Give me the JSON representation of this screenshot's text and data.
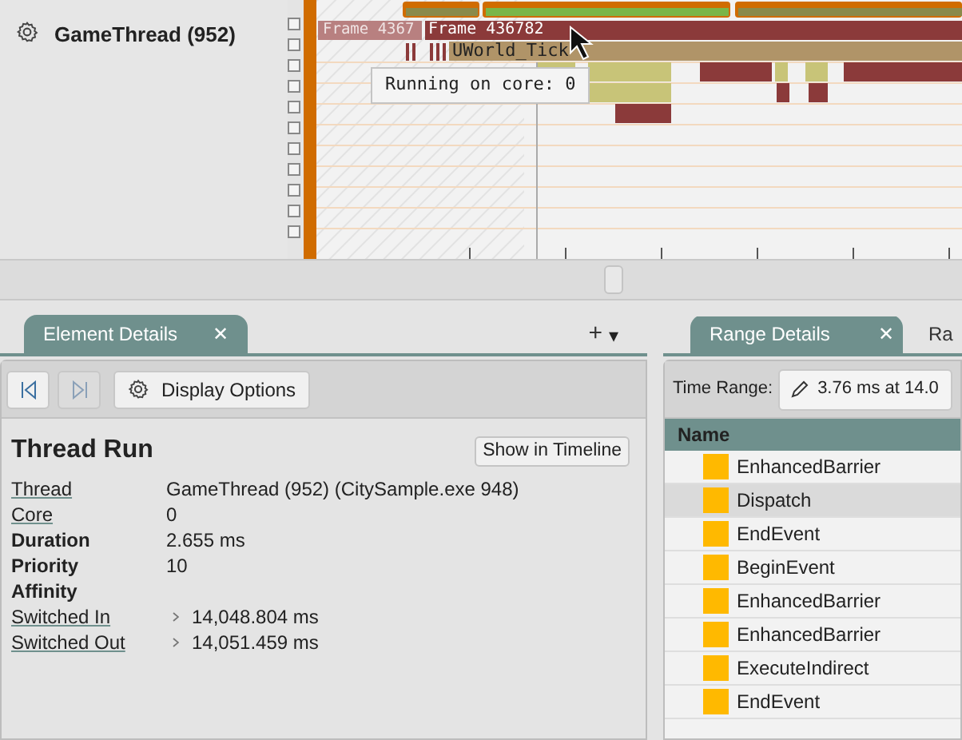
{
  "thread_track": {
    "name": "GameThread (952)",
    "lanes": [
      {
        "checked": false
      },
      {
        "checked": false
      },
      {
        "checked": false
      },
      {
        "checked": false
      },
      {
        "checked": false
      },
      {
        "checked": false
      },
      {
        "checked": false
      },
      {
        "checked": false
      },
      {
        "checked": false
      },
      {
        "checked": false
      },
      {
        "checked": false
      }
    ]
  },
  "timeline": {
    "frames": [
      "Frame 4367",
      "Frame 436782"
    ],
    "event": "UWorld_Tick",
    "tooltip": "Running on core: 0"
  },
  "element_panel": {
    "tab": {
      "label": "Element Details",
      "close": "✕",
      "selected": true
    },
    "add": "+",
    "menu": "▾",
    "display_options": "Display Options",
    "title": "Thread Run",
    "show_in_timeline": "Show in Timeline",
    "fields": [
      {
        "label": "Thread",
        "kind": "link",
        "value": "GameThread (952) (CitySample.exe 948)",
        "expandable": false
      },
      {
        "label": "Core",
        "kind": "link",
        "value": "0",
        "expandable": false
      },
      {
        "label": "Duration",
        "kind": "bold",
        "value": "2.655 ms",
        "expandable": false
      },
      {
        "label": "Priority",
        "kind": "bold",
        "value": "10",
        "expandable": false
      },
      {
        "label": "Affinity",
        "kind": "bold",
        "expandable": false
      },
      {
        "label": "Switched In",
        "kind": "link",
        "value": "14,048.804 ms",
        "expandable": true
      },
      {
        "label": "Switched Out",
        "kind": "link",
        "value": "14,051.459 ms",
        "expandable": true
      }
    ]
  },
  "range_panel": {
    "tabs": [
      {
        "label": "Range Details",
        "close": "✕",
        "selected": true
      },
      {
        "label": "Ra",
        "selected": false
      }
    ],
    "time_range_label": "Time Range:",
    "time_range_value": "3.76 ms at 14.0",
    "column": "Name",
    "rows": [
      {
        "name": "EnhancedBarrier",
        "selected": false
      },
      {
        "name": "Dispatch",
        "selected": true
      },
      {
        "name": "EndEvent",
        "selected": false
      },
      {
        "name": "BeginEvent",
        "selected": false
      },
      {
        "name": "EnhancedBarrier",
        "selected": false
      },
      {
        "name": "EnhancedBarrier",
        "selected": false
      },
      {
        "name": "ExecuteIndirect",
        "selected": false
      },
      {
        "name": "EndEvent",
        "selected": false
      }
    ]
  }
}
